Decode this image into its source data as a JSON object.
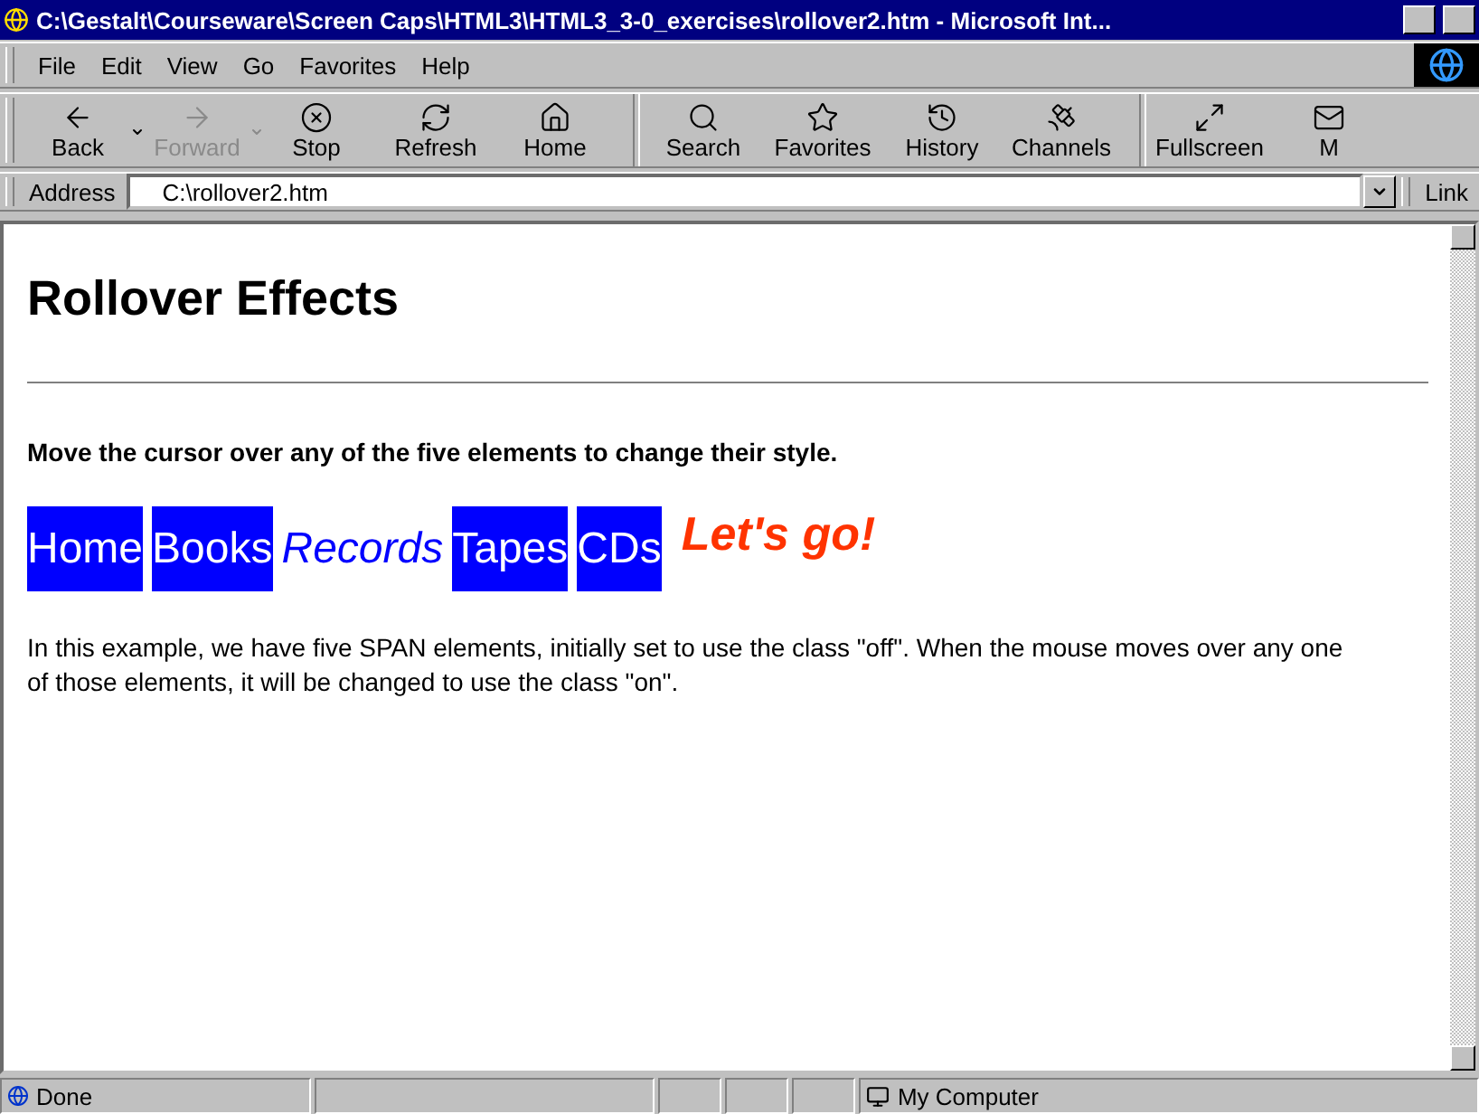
{
  "window": {
    "title": "C:\\Gestalt\\Courseware\\Screen Caps\\HTML3\\HTML3_3-0_exercises\\rollover2.htm - Microsoft Int..."
  },
  "menu": [
    "File",
    "Edit",
    "View",
    "Go",
    "Favorites",
    "Help"
  ],
  "toolbar": [
    {
      "label": "Back",
      "kind": "back",
      "disabled": false,
      "dropdown": true
    },
    {
      "label": "Forward",
      "kind": "forward",
      "disabled": true,
      "dropdown": true
    },
    {
      "label": "Stop",
      "kind": "stop",
      "disabled": false,
      "dropdown": false
    },
    {
      "label": "Refresh",
      "kind": "refresh",
      "disabled": false,
      "dropdown": false
    },
    {
      "label": "Home",
      "kind": "home",
      "disabled": false,
      "dropdown": false
    },
    {
      "kind": "separator"
    },
    {
      "label": "Search",
      "kind": "search",
      "disabled": false,
      "dropdown": false
    },
    {
      "label": "Favorites",
      "kind": "favorites",
      "disabled": false,
      "dropdown": false
    },
    {
      "label": "History",
      "kind": "history",
      "disabled": false,
      "dropdown": false
    },
    {
      "label": "Channels",
      "kind": "channels",
      "disabled": false,
      "dropdown": false
    },
    {
      "kind": "separator"
    },
    {
      "label": "Fullscreen",
      "kind": "fullscreen",
      "disabled": false,
      "dropdown": false
    },
    {
      "label": "M",
      "kind": "mail",
      "disabled": false,
      "dropdown": false
    }
  ],
  "address": {
    "label": "Address",
    "value": "C:\\rollover2.htm",
    "links": "Link"
  },
  "page": {
    "heading": "Rollover Effects",
    "instruction": "Move the cursor over any of the five elements to change their style.",
    "items": [
      {
        "label": "Home",
        "on": false
      },
      {
        "label": "Books",
        "on": false
      },
      {
        "label": "Records",
        "on": true
      },
      {
        "label": "Tapes",
        "on": false
      },
      {
        "label": "CDs",
        "on": false
      }
    ],
    "go": "Let's go!",
    "body": "In this example, we have five SPAN elements, initially set to use the class \"off\". When the mouse moves over any one of those elements, it will be changed to use the class \"on\"."
  },
  "status_bar": {
    "status": "Done",
    "zone": "My Computer"
  }
}
